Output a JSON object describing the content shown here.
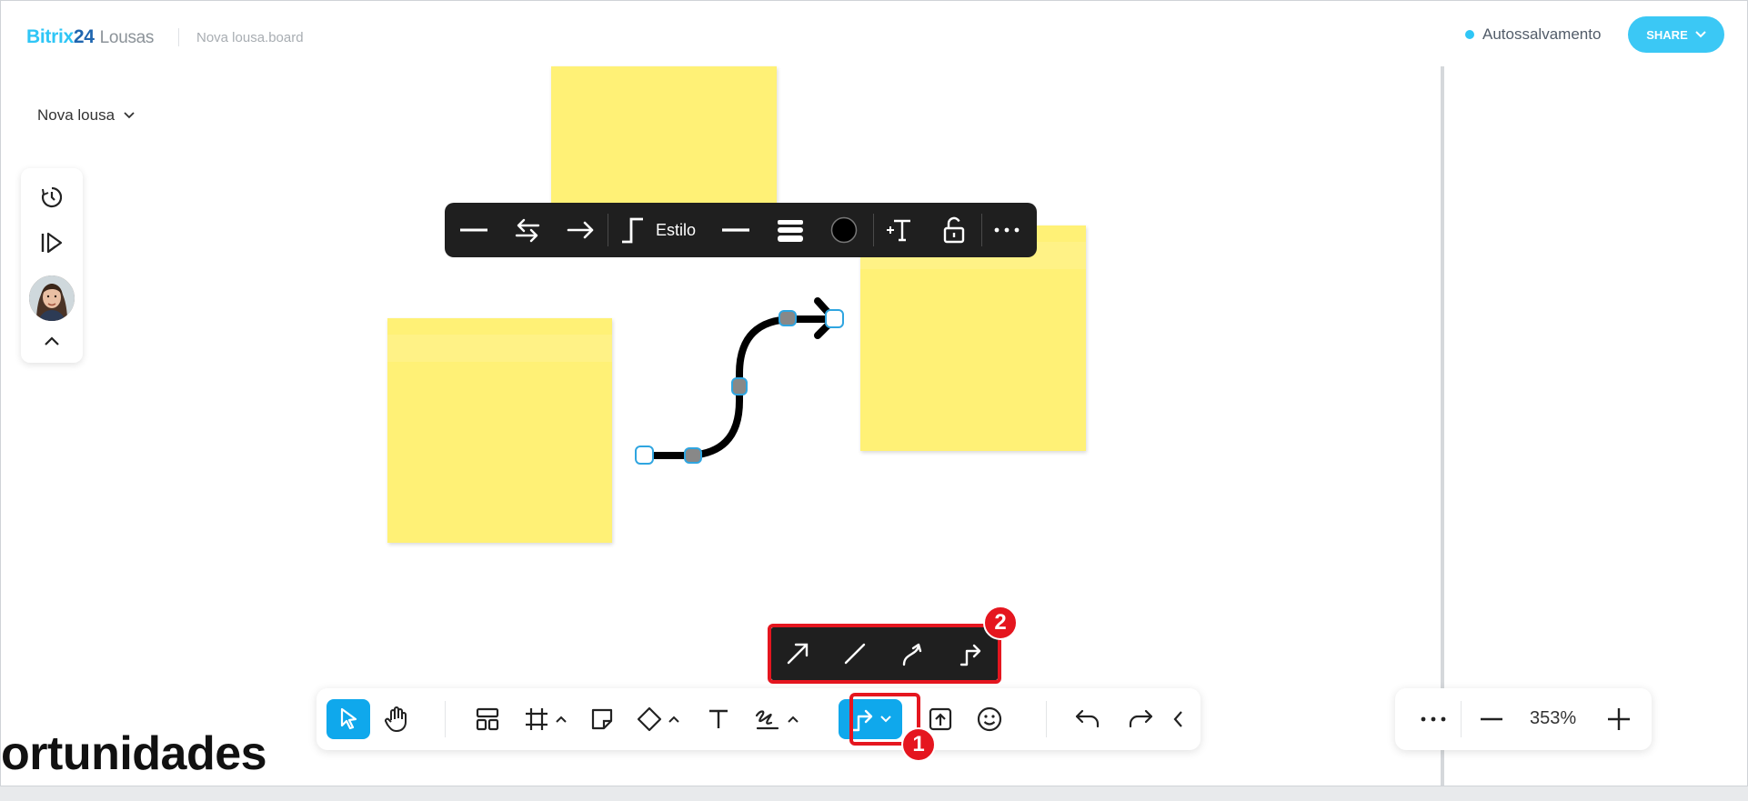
{
  "header": {
    "brand_primary": "Bitrix",
    "brand_number": "24",
    "brand_product": "Lousas",
    "file_name": "Nova lousa.board",
    "autosave_label": "Autossalvamento",
    "share_label": "SHARE"
  },
  "board": {
    "name": "Nova lousa"
  },
  "left_panel": {
    "items": [
      {
        "icon": "timer-icon"
      },
      {
        "icon": "presentation-pointer-icon"
      },
      {
        "icon": "avatar"
      },
      {
        "icon": "chevron-up-icon"
      }
    ]
  },
  "connector_toolbar": {
    "items": [
      {
        "icon": "line-start-none-icon"
      },
      {
        "icon": "swap-direction-icon"
      },
      {
        "icon": "line-end-arrow-icon"
      },
      {
        "icon": "elbow-style-icon"
      },
      {
        "icon": "line-dash-icon"
      },
      {
        "icon": "line-thickness-icon"
      },
      {
        "icon": "color-swatch-icon"
      },
      {
        "icon": "add-text-icon"
      },
      {
        "icon": "unlock-icon"
      },
      {
        "icon": "more-icon"
      }
    ],
    "style_label": "Estilo",
    "stroke_color": "#000000"
  },
  "arrow_popup": {
    "items": [
      {
        "icon": "straight-arrow-icon"
      },
      {
        "icon": "straight-line-icon"
      },
      {
        "icon": "curved-arrow-icon"
      },
      {
        "icon": "elbow-arrow-icon"
      }
    ]
  },
  "bottom_toolbar": {
    "items": [
      {
        "icon": "select-pointer-icon",
        "active": true
      },
      {
        "icon": "hand-pan-icon"
      },
      {
        "icon": "templates-icon"
      },
      {
        "icon": "frame-icon"
      },
      {
        "icon": "sticky-note-icon"
      },
      {
        "icon": "shapes-icon"
      },
      {
        "icon": "text-icon"
      },
      {
        "icon": "pen-icon"
      },
      {
        "icon": "connector-icon",
        "active": true
      },
      {
        "icon": "upload-icon"
      },
      {
        "icon": "emoji-icon"
      },
      {
        "icon": "undo-icon"
      },
      {
        "icon": "redo-icon"
      },
      {
        "icon": "collapse-left-icon"
      }
    ]
  },
  "zoom": {
    "value": "353%"
  },
  "annotations": {
    "badge_1": "1",
    "badge_2": "2"
  },
  "canvas_text": "ortunidades",
  "colors": {
    "accent": "#0fa8ec",
    "brand": "#2fc6f6",
    "sticky": "#fff176",
    "highlight": "#e5161f",
    "toolbar_dark": "#1f1f1f"
  }
}
